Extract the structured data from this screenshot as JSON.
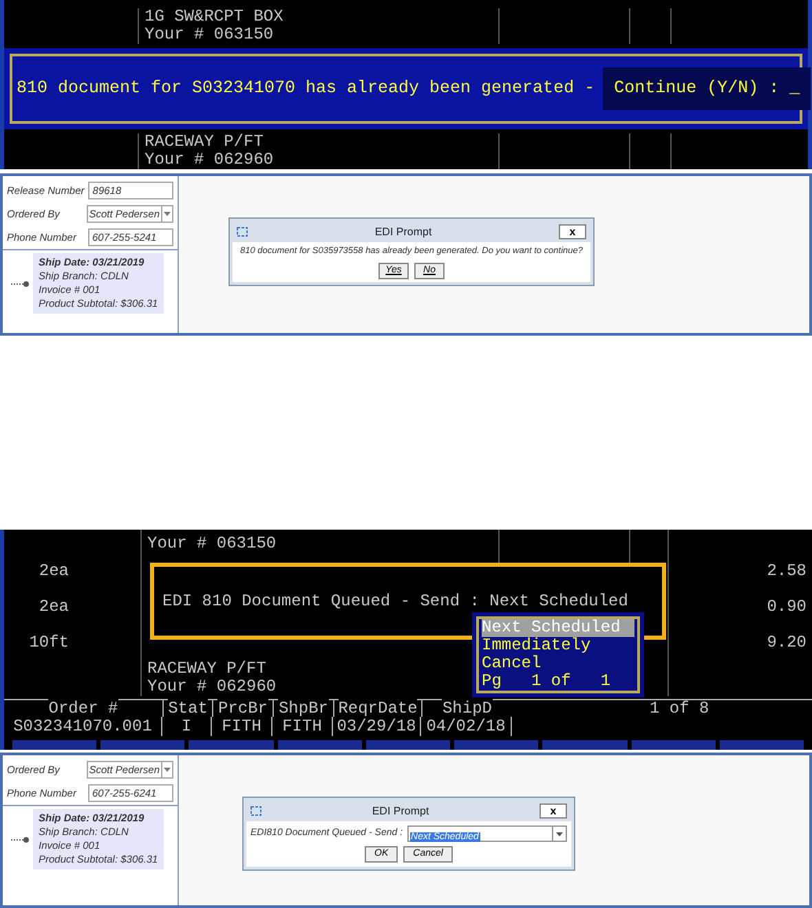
{
  "terminal_confirm": {
    "lines_above": [
      "1G SW&RCPT BOX",
      "Your # 063150"
    ],
    "message": "810 document for S032341070 has already been generated -",
    "prompt": "Continue (Y/N) : _",
    "lines_below": [
      "RACEWAY P/FT",
      "Your # 062960"
    ]
  },
  "gui_confirm": {
    "fields": [
      {
        "label": "Release Number",
        "value": "89618",
        "kind": "text"
      },
      {
        "label": "Ordered By",
        "value": "Scott Pedersen",
        "kind": "dropdown"
      },
      {
        "label": "Phone Number",
        "value": "607-255-5241",
        "kind": "text"
      }
    ],
    "ship": {
      "title": "Ship Date: 03/21/2019",
      "lines": [
        "Ship Branch: CDLN",
        "Invoice # 001",
        "Product Subtotal: $306.31"
      ]
    },
    "dialog": {
      "title": "EDI Prompt",
      "close": "x",
      "message": "810 document for S035973558 has already been generated. Do you want to continue?",
      "buttons": [
        "Yes",
        "No"
      ]
    }
  },
  "terminal_queued": {
    "top_line": "Your # 063150",
    "rows": [
      {
        "qty": "2ea",
        "price": "2.58"
      },
      {
        "qty": "2ea",
        "price": "0.90"
      },
      {
        "qty": "10ft",
        "price": "9.20"
      }
    ],
    "lines_below": [
      "RACEWAY P/FT",
      "Your # 062960"
    ],
    "prompt": "EDI 810 Document Queued - Send : Next Scheduled",
    "menu": {
      "items": [
        {
          "label": "Next Scheduled",
          "selected": true
        },
        {
          "label": "Immediately",
          "selected": false
        },
        {
          "label": "Cancel",
          "selected": false
        }
      ],
      "footer": "Pg   1 of   1"
    },
    "headers": [
      "Order #",
      "Stat",
      "PrcBr",
      "ShpBr",
      "ReqrDate",
      "ShipD"
    ],
    "values": [
      "S032341070.001",
      "I",
      "FITH",
      "FITH",
      "03/29/18",
      "04/02/18"
    ],
    "page": "1 of 8"
  },
  "gui_queued": {
    "fields": [
      {
        "label": "Ordered By",
        "value": "Scott Pedersen",
        "kind": "dropdown"
      },
      {
        "label": "Phone Number",
        "value": "607-255-6241",
        "kind": "text"
      }
    ],
    "ship": {
      "title": "Ship Date: 03/21/2019",
      "lines": [
        "Ship Branch: CDLN",
        "Invoice # 001",
        "Product Subtotal: $306.31"
      ]
    },
    "dialog": {
      "title": "EDI Prompt",
      "close": "x",
      "label": "EDI810 Document Queued - Send :",
      "value": "Next Scheduled",
      "buttons": [
        "OK",
        "Cancel"
      ]
    }
  }
}
